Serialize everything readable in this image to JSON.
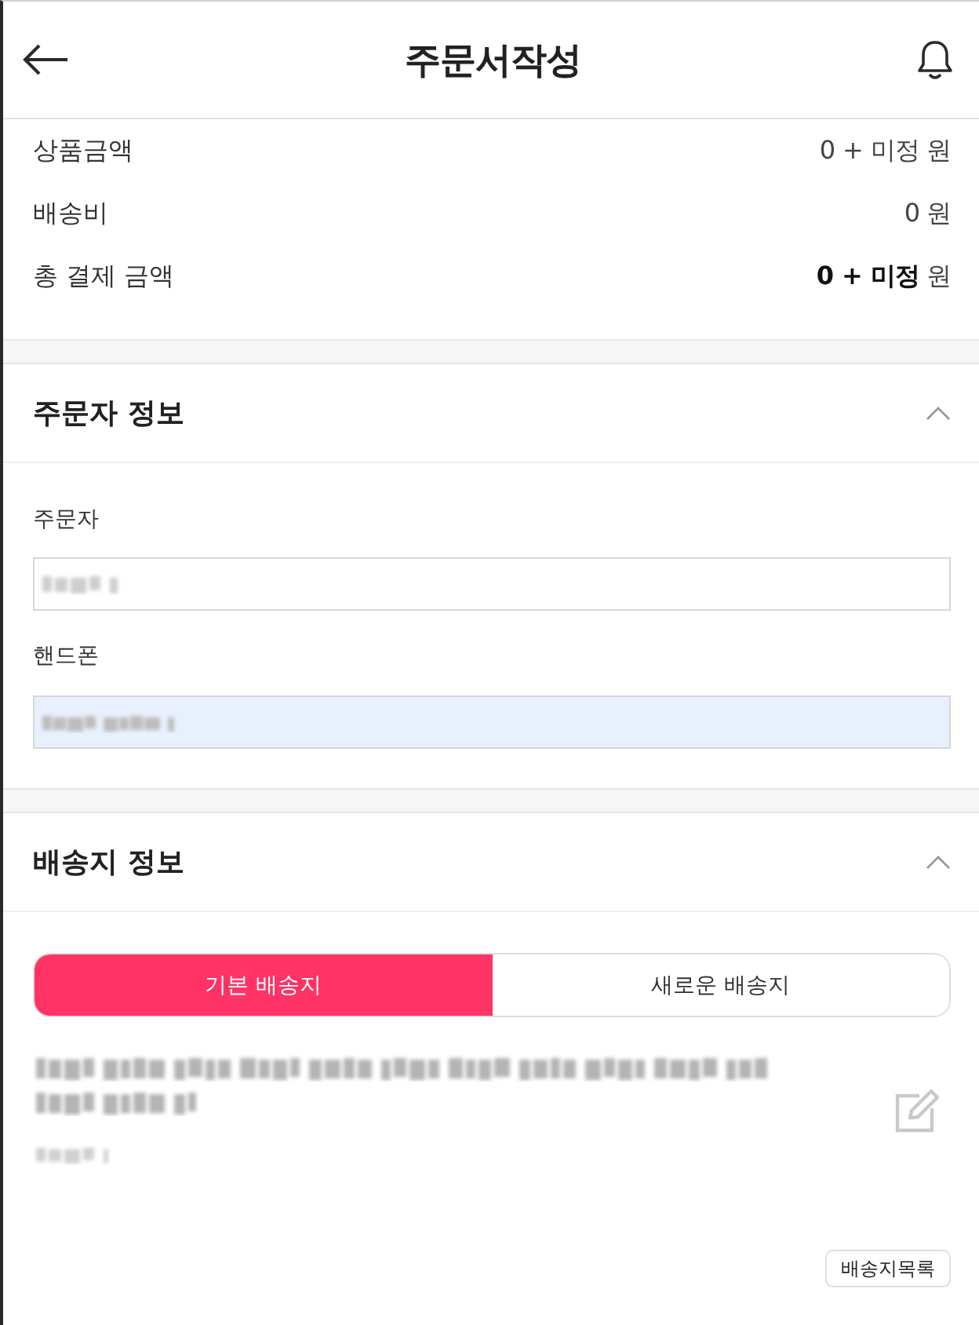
{
  "header": {
    "title": "주문서작성"
  },
  "summary": [
    {
      "label": "상품금액",
      "amount": "0 + 미정",
      "unit": "원",
      "emphasized": false
    },
    {
      "label": "배송비",
      "amount": "0",
      "unit": "원",
      "emphasized": false
    },
    {
      "label": "총 결제 금액",
      "amount": "0 + 미정",
      "unit": "원",
      "emphasized": true
    }
  ],
  "orderer_section": {
    "title": "주문자 정보",
    "expanded": true,
    "fields": [
      {
        "label": "주문자",
        "autofilled": false
      },
      {
        "label": "핸드폰",
        "autofilled": true
      }
    ]
  },
  "shipping_section": {
    "title": "배송지 정보",
    "expanded": true,
    "tabs": [
      {
        "label": "기본 배송지",
        "selected": true
      },
      {
        "label": "새로운 배송지",
        "selected": false
      }
    ],
    "address_list_button": "배송지목록"
  }
}
